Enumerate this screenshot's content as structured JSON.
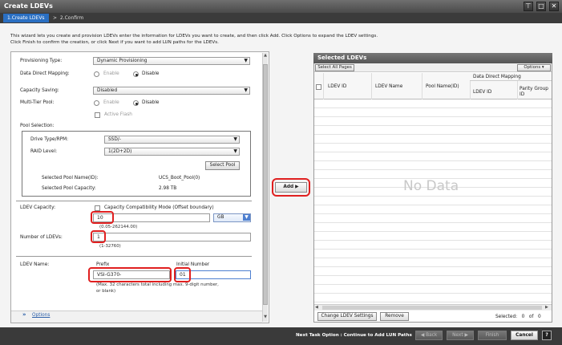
{
  "window": {
    "title": "Create LDEVs"
  },
  "steps": {
    "step1": "1.Create LDEVs",
    "sep": ">",
    "step2": "2.Confirm"
  },
  "instructions": {
    "line1": "This wizard lets you create and provision LDEVs enter the information for  LDEVs you want to create, and then click Add. Click Options to expand the LDEV settings.",
    "line2": "Click Finish to confirm the creation, or click Next if you want to add LUN paths for the LDEVs."
  },
  "form": {
    "provisioning_type": {
      "label": "Provisioning Type:",
      "value": "Dynamic Provisioning"
    },
    "data_direct_mapping": {
      "label": "Data Direct Mapping:",
      "enable": "Enable",
      "disable": "Disable"
    },
    "capacity_saving": {
      "label": "Capacity Saving:",
      "value": "Disabled"
    },
    "multi_tier_pool": {
      "label": "Multi-Tier Pool:",
      "enable": "Enable",
      "disable": "Disable",
      "active_flash": "Active Flash"
    },
    "pool_selection": {
      "label": "Pool Selection:",
      "drive_type_label": "Drive Type/RPM:",
      "drive_type_value": "SSD/-",
      "raid_level_label": "RAID Level:",
      "raid_level_value": "1(2D+2D)",
      "select_pool_button": "Select Pool",
      "selected_pool_name_label": "Selected Pool Name(ID):",
      "selected_pool_name_value": "UCS_Boot_Pool(0)",
      "selected_pool_capacity_label": "Selected Pool Capacity:",
      "selected_pool_capacity_value": "2.98 TB"
    },
    "ldev_capacity": {
      "label": "LDEV Capacity:",
      "compat_mode": "Capacity Compatibility Mode (Offset boundary)",
      "value": "10",
      "unit": "GB",
      "range": "(0.05-262144.00)"
    },
    "number_of_ldevs": {
      "label": "Number of LDEVs:",
      "value": "1",
      "range": "(1-32760)"
    },
    "ldev_name": {
      "label": "LDEV Name:",
      "prefix_label": "Prefix",
      "prefix_value": "VSI-G370-",
      "initial_number_label": "Initial Number",
      "initial_number_value": "01",
      "hint1": "(Max. 32 characters total including max. 9-digit number,",
      "hint2": "or blank)"
    },
    "options_link": "Options"
  },
  "add_button": "Add",
  "selected_ldevs": {
    "title": "Selected LDEVs",
    "select_all": "Select All Pages",
    "options": "Options",
    "columns": {
      "ldev_id": "LDEV ID",
      "ldev_name": "LDEV Name",
      "pool_name": "Pool Name(ID)",
      "ddm": "Data Direct Mapping",
      "ddm_ldev_id": "LDEV ID",
      "parity_group_1": "Parity Group",
      "parity_group_2": "ID"
    },
    "no_data": "No Data",
    "change_settings": "Change LDEV Settings",
    "remove": "Remove",
    "selected_label": "Selected:",
    "selected_count": "0",
    "of_label": "of",
    "total_count": "0"
  },
  "footer": {
    "next_task_label": "Next Task Option",
    "next_task_sep": ":",
    "next_task_value": "Continue to Add LUN Paths",
    "back": "◀ Back",
    "next": "Next ▶",
    "finish": "Finish",
    "cancel": "Cancel",
    "help": "?"
  },
  "colors": {
    "accent": "#2a6fc2",
    "highlight": "#e02020",
    "header": "#555555"
  }
}
